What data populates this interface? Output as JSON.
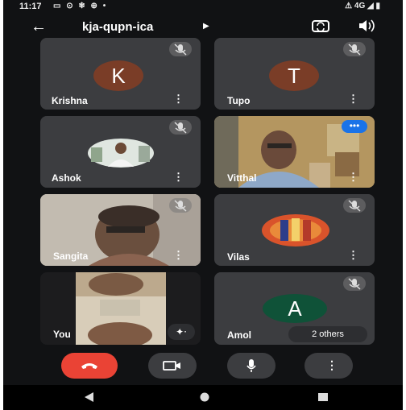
{
  "status_bar": {
    "time": "11:17",
    "notification_icons": "▭ ⊙ ❄ ⊕ •",
    "right_icons": "⚠ 4G ◢ ▮"
  },
  "meeting": {
    "code": "kja-qupn-ica"
  },
  "participants": [
    {
      "name": "Krishna",
      "initial": "K",
      "avatar_color": "#7a3d27",
      "muted": true,
      "video": false
    },
    {
      "name": "Tupo",
      "initial": "T",
      "avatar_color": "#7a3d27",
      "muted": true,
      "video": false
    },
    {
      "name": "Ashok",
      "muted": true,
      "video": false,
      "avatar_type": "photo"
    },
    {
      "name": "Vitthal",
      "muted": false,
      "video": true,
      "speaking_indicator": "•••"
    },
    {
      "name": "Sangita",
      "muted": true,
      "video": true
    },
    {
      "name": "Vilas",
      "muted": true,
      "video": false,
      "avatar_type": "photo"
    },
    {
      "name": "You",
      "muted": false,
      "video": true
    },
    {
      "name": "Amol",
      "initial": "A",
      "avatar_color": "#0f5238",
      "muted": true,
      "video": false
    }
  ],
  "others_badge": "2 others",
  "controls": [
    "end-call",
    "camera",
    "microphone",
    "more-options"
  ],
  "colors": {
    "end_call": "#ea4335",
    "tile_bg": "#3c3d40",
    "speaking": "#1a73e8"
  }
}
